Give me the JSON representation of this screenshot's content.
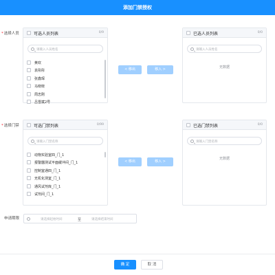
{
  "dialog": {
    "title": "添加门禁授权"
  },
  "personnel": {
    "label": "选择人员",
    "available": {
      "title": "可选人员列表",
      "count": "0/9",
      "search_placeholder": "请输入人员姓名",
      "items": [
        {
          "label": "黄欢"
        },
        {
          "label": "袁彤彤"
        },
        {
          "label": "张鑫琛"
        },
        {
          "label": "马晓晓"
        },
        {
          "label": "周志刚"
        },
        {
          "label": "吕雪斌2号"
        }
      ]
    },
    "selected": {
      "title": "已选人员列表",
      "count": "0/0",
      "empty_text": "无数据"
    },
    "transfer": {
      "left_label": "< 移出",
      "right_label": "移入 >"
    }
  },
  "doors": {
    "label": "选择门禁",
    "available": {
      "title": "可选门禁列表",
      "count": "0/99",
      "search_placeholder": "请输入门禁名称",
      "items": [
        {
          "label": "动物实验室四_门_1"
        },
        {
          "label": "报警器测试平面缓冲间_门_1"
        },
        {
          "label": "控制室通四_门_1"
        },
        {
          "label": "无机化测室_门_1"
        },
        {
          "label": "通风试剂库_门_1"
        },
        {
          "label": "试剂间_门_1"
        }
      ]
    },
    "selected": {
      "title": "已选门禁列表",
      "count": "0/0",
      "empty_text": "无数据"
    },
    "transfer": {
      "left_label": "< 移出",
      "right_label": "移入 >"
    }
  },
  "validity": {
    "label": "申请期限",
    "start_placeholder": "请选择起始时间",
    "separator": "至",
    "end_placeholder": "请选择结束时间"
  },
  "footer": {
    "confirm_label": "确 定",
    "cancel_label": "取 消"
  },
  "colors": {
    "primary": "#1890ff",
    "disabled_primary": "#a0cfff",
    "required": "#f5222d"
  }
}
